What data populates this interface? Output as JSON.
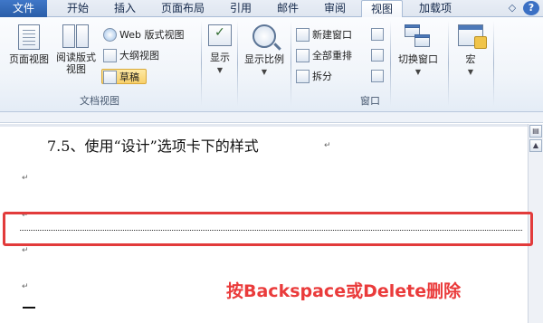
{
  "tabs": {
    "file": "文件",
    "home": "开始",
    "insert": "插入",
    "page_layout": "页面布局",
    "references": "引用",
    "mailings": "邮件",
    "review": "审阅",
    "view": "视图",
    "addins": "加载项",
    "active": "视图"
  },
  "ribbon": {
    "document_views": {
      "label": "文档视图",
      "page_view": "页面视图",
      "reading_view_line1": "阅读版式",
      "reading_view_line2": "视图",
      "web_view": "Web 版式视图",
      "outline_view": "大纲视图",
      "draft_view": "草稿",
      "selected": "草稿"
    },
    "show": {
      "label": "显示"
    },
    "zoom": {
      "label": "显示比例"
    },
    "window": {
      "label": "窗口",
      "new_window": "新建窗口",
      "arrange_all": "全部重排",
      "split": "拆分",
      "switch_windows": "切换窗口"
    },
    "macros": {
      "label": "宏"
    }
  },
  "document": {
    "heading": "7.5、使用“设计”选项卡下的样式",
    "paragraph_mark": "↵"
  },
  "annotation": {
    "text": "按Backspace或Delete删除",
    "color": "#ea3b3b"
  },
  "colors": {
    "file_tab": "#2a5ea8",
    "highlight_border": "#e23b3b",
    "selected_button": "#f8d06a"
  }
}
